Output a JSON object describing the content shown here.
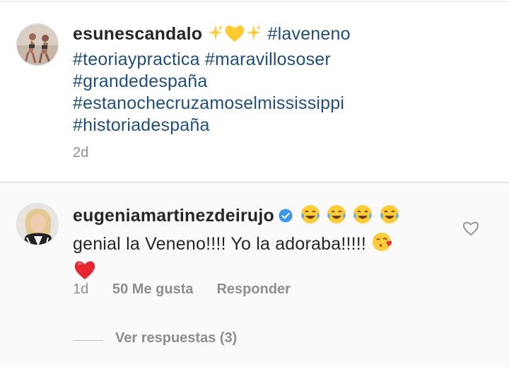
{
  "post": {
    "username": "esunescandalo",
    "emoji": [
      "sparkles-emoji",
      "yellow-heart-emoji",
      "sparkles-emoji"
    ],
    "hashtags": {
      "h1": "#laveneno",
      "h2": "#teoriaypractica",
      "h3": "#maravillososer",
      "h4": "#grandedespaña",
      "h5": "#estanochecruzamoselmississippi",
      "h6": "#historiadespaña"
    },
    "time": "2d"
  },
  "comment": {
    "username": "eugeniamartinezdeirujo",
    "verified": true,
    "emoji_lead": [
      "tears-of-joy-emoji",
      "tears-of-joy-emoji",
      "tears-of-joy-emoji",
      "tears-of-joy-emoji"
    ],
    "text": "genial la Veneno!!!! Yo la adoraba!!!!!",
    "emoji_tail": [
      "kissing-heart-emoji",
      "red-heart-emoji"
    ],
    "time": "1d",
    "likes": "50 Me gusta",
    "reply_label": "Responder",
    "view_replies": "Ver respuestas (3)"
  },
  "colors": {
    "hashtag": "#1d4f86",
    "meta": "#8e8e8e",
    "verified": "#3897f0"
  }
}
